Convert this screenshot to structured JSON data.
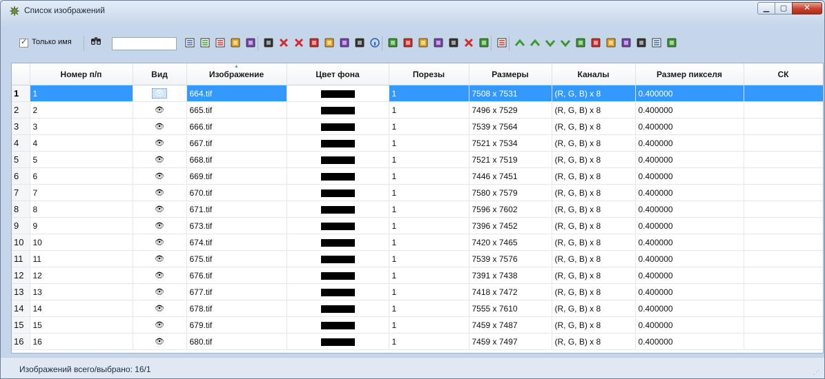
{
  "window": {
    "title": "Список изображений",
    "min_glyph": "▁",
    "max_glyph": "▢",
    "close_glyph": "✕",
    "title_icon": "image-list-icon"
  },
  "toolbar": {
    "only_name_label": "Только имя",
    "only_name_checked": true,
    "search_value": "",
    "icons": [
      "list-icon",
      "list-icon",
      "list-icon",
      "add-row-icon",
      "add-row-icon",
      "new-image-icon",
      "delete-icon",
      "delete-all-icon",
      "save-icon",
      "image-icon",
      "image-remove-icon",
      "refresh-icon",
      "info-icon",
      "chart-icon",
      "color-icon",
      "histogram-icon",
      "link-icon",
      "folder-icon",
      "cross-icon",
      "warning-icon",
      "layers-icon",
      "arrow-up-double-icon",
      "arrow-up-icon",
      "arrow-down-icon",
      "arrow-down-double-icon",
      "sort-icon",
      "split-icon",
      "save-disk-icon",
      "import-icon",
      "edit-icon",
      "table-icon",
      "ccc-icon"
    ],
    "colors": {
      "accent": "#3399ff",
      "icon_green": "#3a9a2d",
      "icon_red": "#d12b2b",
      "icon_blue": "#2b5fb0"
    }
  },
  "table": {
    "columns": [
      "",
      "Номер п/п",
      "Вид",
      "Изображение",
      "Цвет фона",
      "Порезы",
      "Размеры",
      "Каналы",
      "Размер пикселя",
      "СК"
    ],
    "sorted_column": "Изображение",
    "selected_row": 1,
    "rows": [
      {
        "idx": "1",
        "num": "1",
        "vid": "👁",
        "image": "664.tif",
        "bg": "#000000",
        "cuts": "1",
        "size": "7508 x 7531",
        "channels": "(R, G, B) x 8",
        "pixel": "0.400000",
        "sk": ""
      },
      {
        "idx": "2",
        "num": "2",
        "vid": "👁",
        "image": "665.tif",
        "bg": "#000000",
        "cuts": "1",
        "size": "7496 x 7529",
        "channels": "(R, G, B) x 8",
        "pixel": "0.400000",
        "sk": ""
      },
      {
        "idx": "3",
        "num": "3",
        "vid": "👁",
        "image": "666.tif",
        "bg": "#000000",
        "cuts": "1",
        "size": "7539 x 7564",
        "channels": "(R, G, B) x 8",
        "pixel": "0.400000",
        "sk": ""
      },
      {
        "idx": "4",
        "num": "4",
        "vid": "👁",
        "image": "667.tif",
        "bg": "#000000",
        "cuts": "1",
        "size": "7521 x 7534",
        "channels": "(R, G, B) x 8",
        "pixel": "0.400000",
        "sk": ""
      },
      {
        "idx": "5",
        "num": "5",
        "vid": "👁",
        "image": "668.tif",
        "bg": "#000000",
        "cuts": "1",
        "size": "7521 x 7519",
        "channels": "(R, G, B) x 8",
        "pixel": "0.400000",
        "sk": ""
      },
      {
        "idx": "6",
        "num": "6",
        "vid": "👁",
        "image": "669.tif",
        "bg": "#000000",
        "cuts": "1",
        "size": "7446 x 7451",
        "channels": "(R, G, B) x 8",
        "pixel": "0.400000",
        "sk": ""
      },
      {
        "idx": "7",
        "num": "7",
        "vid": "👁",
        "image": "670.tif",
        "bg": "#000000",
        "cuts": "1",
        "size": "7580 x 7579",
        "channels": "(R, G, B) x 8",
        "pixel": "0.400000",
        "sk": ""
      },
      {
        "idx": "8",
        "num": "8",
        "vid": "👁",
        "image": "671.tif",
        "bg": "#000000",
        "cuts": "1",
        "size": "7596 x 7602",
        "channels": "(R, G, B) x 8",
        "pixel": "0.400000",
        "sk": ""
      },
      {
        "idx": "9",
        "num": "9",
        "vid": "👁",
        "image": "673.tif",
        "bg": "#000000",
        "cuts": "1",
        "size": "7396 x 7452",
        "channels": "(R, G, B) x 8",
        "pixel": "0.400000",
        "sk": ""
      },
      {
        "idx": "10",
        "num": "10",
        "vid": "👁",
        "image": "674.tif",
        "bg": "#000000",
        "cuts": "1",
        "size": "7420 x 7465",
        "channels": "(R, G, B) x 8",
        "pixel": "0.400000",
        "sk": ""
      },
      {
        "idx": "11",
        "num": "11",
        "vid": "👁",
        "image": "675.tif",
        "bg": "#000000",
        "cuts": "1",
        "size": "7539 x 7576",
        "channels": "(R, G, B) x 8",
        "pixel": "0.400000",
        "sk": ""
      },
      {
        "idx": "12",
        "num": "12",
        "vid": "👁",
        "image": "676.tif",
        "bg": "#000000",
        "cuts": "1",
        "size": "7391 x 7438",
        "channels": "(R, G, B) x 8",
        "pixel": "0.400000",
        "sk": ""
      },
      {
        "idx": "13",
        "num": "13",
        "vid": "👁",
        "image": "677.tif",
        "bg": "#000000",
        "cuts": "1",
        "size": "7418 x 7472",
        "channels": "(R, G, B) x 8",
        "pixel": "0.400000",
        "sk": ""
      },
      {
        "idx": "14",
        "num": "14",
        "vid": "👁",
        "image": "678.tif",
        "bg": "#000000",
        "cuts": "1",
        "size": "7555 x 7610",
        "channels": "(R, G, B) x 8",
        "pixel": "0.400000",
        "sk": ""
      },
      {
        "idx": "15",
        "num": "15",
        "vid": "👁",
        "image": "679.tif",
        "bg": "#000000",
        "cuts": "1",
        "size": "7459 x 7487",
        "channels": "(R, G, B) x 8",
        "pixel": "0.400000",
        "sk": ""
      },
      {
        "idx": "16",
        "num": "16",
        "vid": "👁",
        "image": "680.tif",
        "bg": "#000000",
        "cuts": "1",
        "size": "7459 x 7497",
        "channels": "(R, G, B) x 8",
        "pixel": "0.400000",
        "sk": ""
      }
    ]
  },
  "status": {
    "text": "Изображений всего/выбрано: 16/1"
  }
}
